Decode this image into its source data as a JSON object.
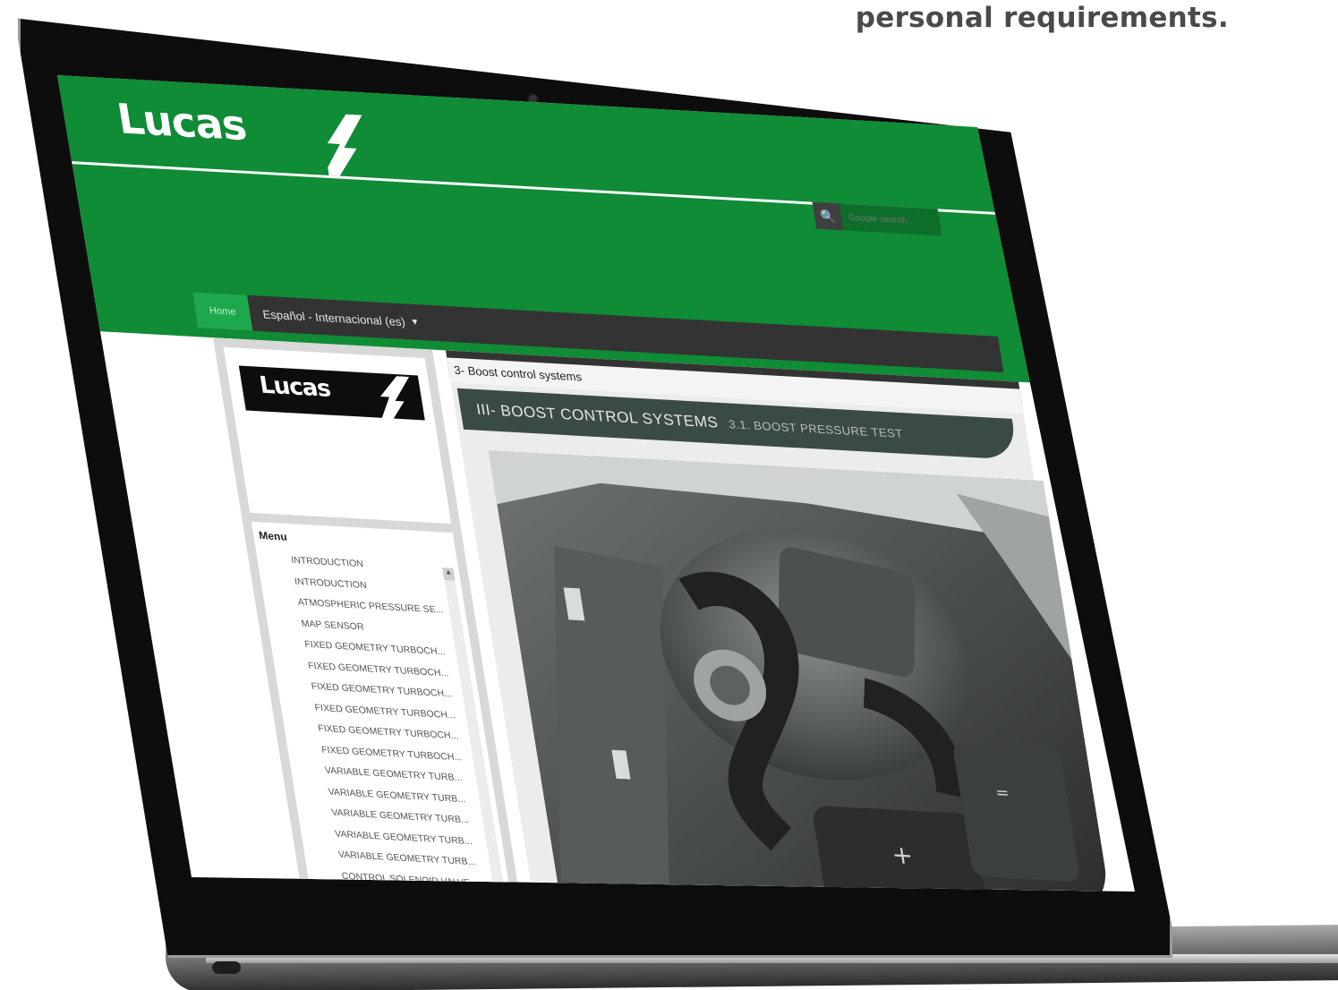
{
  "tagline": "personal requirements.",
  "header": {
    "logo_text": "Lucas",
    "search_placeholder": "Google search..."
  },
  "nav": {
    "home_label": "Home",
    "language_label": "Español - Internacional (es)",
    "caret": "▼"
  },
  "sidebar": {
    "logo_text": "Lucas",
    "menu_title": "Menu",
    "menu_items": [
      "INTRODUCTION",
      "INTRODUCTION",
      "ATMOSPHERIC PRESSURE SE...",
      "MAP SENSOR",
      "FIXED GEOMETRY TURBOCH...",
      "FIXED GEOMETRY TURBOCH...",
      "FIXED GEOMETRY TURBOCH...",
      "FIXED GEOMETRY TURBOCH...",
      "FIXED GEOMETRY TURBOCH...",
      "FIXED GEOMETRY TURBOCH...",
      "VARIABLE GEOMETRY TURB...",
      "VARIABLE GEOMETRY TURB...",
      "VARIABLE GEOMETRY TURB...",
      "VARIABLE GEOMETRY TURB...",
      "VARIABLE GEOMETRY TURB...",
      "CONTROL SOLENOID VALVE"
    ]
  },
  "content": {
    "breadcrumb": "3- Boost control systems",
    "banner_main": "III- BOOST CONTROL SYSTEMS",
    "banner_sub": "3.1. BOOST PRESSURE TEST"
  },
  "colors": {
    "brand_green": "#108b36",
    "nav_dark": "#333333",
    "banner": "#3a4b43"
  }
}
